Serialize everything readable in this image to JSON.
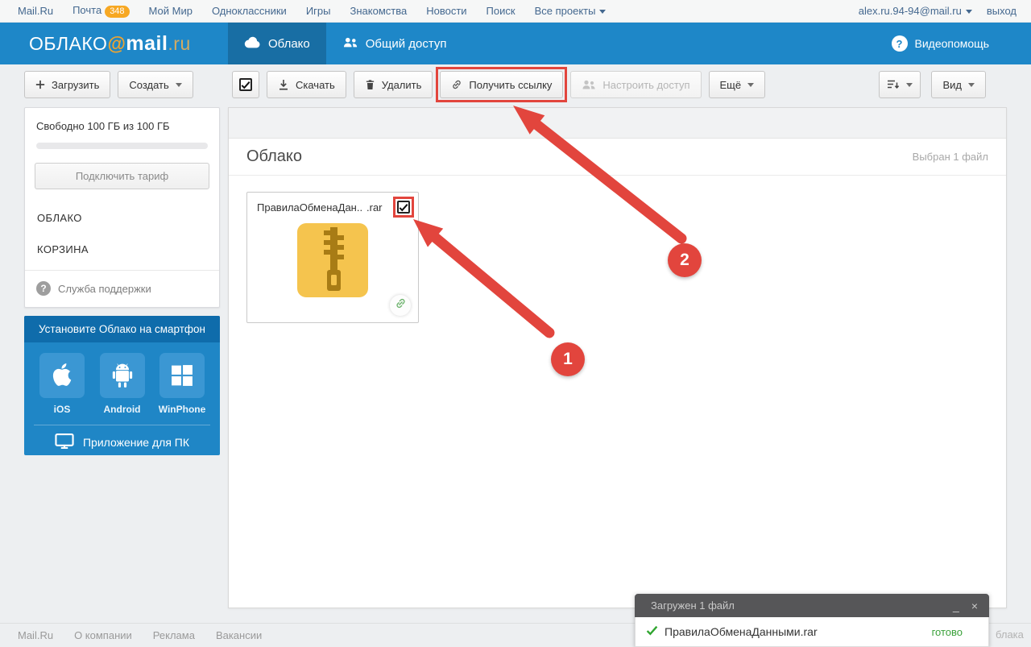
{
  "colors": {
    "header_blue": "#1e87c8",
    "active_tab_blue": "#18709f",
    "promo_blue": "#1f86c6",
    "promo_header_blue": "#0f6cab",
    "annotation_red": "#e2453d",
    "badge_orange": "#f7a823",
    "file_icon_yellow": "#f5c44e",
    "success_green": "#3aa13a"
  },
  "icons": {
    "cloud-icon": "cloud",
    "people-icon": "two people",
    "question-icon": "?",
    "plus-icon": "+",
    "download-icon": "arrow down",
    "trash-icon": "trash can",
    "link-icon": "chain link",
    "sort-icon": "lines with down arrow",
    "monitor-icon": "desktop display",
    "apple-icon": "apple logo",
    "android-icon": "android robot",
    "windows-icon": "four squares",
    "checkmark-icon": "check",
    "caret-down-icon": "▾"
  },
  "topbar": {
    "links": [
      {
        "label": "Mail.Ru"
      },
      {
        "label": "Почта",
        "badge": "348"
      },
      {
        "label": "Мой Мир"
      },
      {
        "label": "Одноклассники"
      },
      {
        "label": "Игры"
      },
      {
        "label": "Знакомства"
      },
      {
        "label": "Новости"
      },
      {
        "label": "Поиск"
      },
      {
        "label": "Все проекты"
      }
    ],
    "user_email": "alex.ru.94-94@mail.ru",
    "logout_label": "выход"
  },
  "header": {
    "logo_part1": "ОБЛАКО",
    "logo_at": "@",
    "logo_part2": "mail",
    "logo_part3": ".ru",
    "tabs": [
      {
        "label": "Облако",
        "active": true
      },
      {
        "label": "Общий доступ",
        "active": false
      }
    ],
    "help_icon_glyph": "?",
    "help_label": "Видеопомощь"
  },
  "toolbar": {
    "upload_label": "Загрузить",
    "create_label": "Создать",
    "download_label": "Скачать",
    "delete_label": "Удалить",
    "get_link_label": "Получить ссылку",
    "share_label": "Настроить доступ",
    "share_disabled": true,
    "more_label": "Ещё",
    "view_label": "Вид"
  },
  "sidebar": {
    "storage_text": "Свободно 100 ГБ из 100 ГБ",
    "tariff_button": "Подключить тариф",
    "nav": [
      {
        "label": "ОБЛАКО"
      },
      {
        "label": "КОРЗИНА"
      }
    ],
    "support_icon_glyph": "?",
    "support_label": "Служба поддержки",
    "promo": {
      "title": "Установите Облако на смартфон",
      "apps": [
        {
          "label": "iOS"
        },
        {
          "label": "Android"
        },
        {
          "label": "WinPhone"
        }
      ],
      "pc_app_label": "Приложение для ПК"
    }
  },
  "main": {
    "title": "Облако",
    "selection_status": "Выбран 1 файл",
    "file": {
      "name": "ПравилаОбменаДан...",
      "ext": ".rar",
      "checked": true
    }
  },
  "annotations": {
    "step1": "1",
    "step2": "2"
  },
  "notification": {
    "title": "Загружен 1 файл",
    "minimize_glyph": "_",
    "close_glyph": "×",
    "file_name": "ПравилаОбменаДанными.rar",
    "status": "готово"
  },
  "footer": {
    "links": [
      "Mail.Ru",
      "О компании",
      "Реклама",
      "Вакансии"
    ],
    "partial_text": "блака"
  }
}
